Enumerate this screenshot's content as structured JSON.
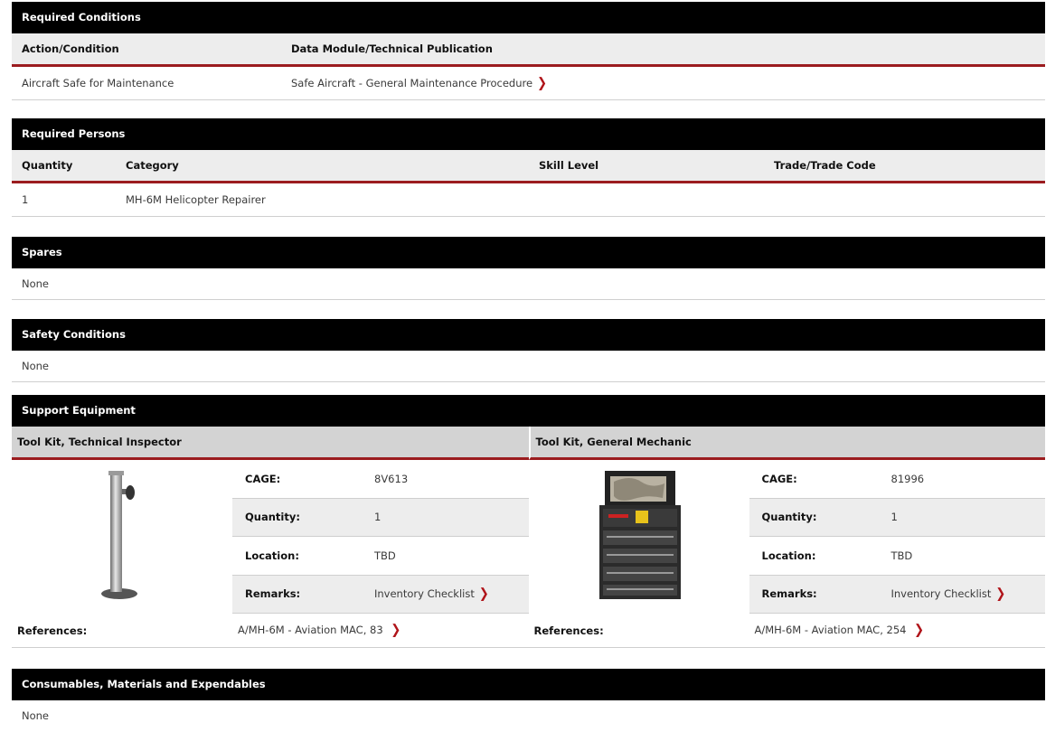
{
  "required_conditions": {
    "title": "Required Conditions",
    "headers": [
      "Action/Condition",
      "Data Module/Technical Publication"
    ],
    "rows": [
      {
        "action": "Aircraft Safe for Maintenance",
        "publication": "Safe Aircraft - General Maintenance Procedure"
      }
    ]
  },
  "required_persons": {
    "title": "Required Persons",
    "headers": [
      "Quantity",
      "Category",
      "Skill Level",
      "Trade/Trade Code"
    ],
    "rows": [
      {
        "quantity": "1",
        "category": "MH-6M Helicopter Repairer",
        "skill": "",
        "trade": ""
      }
    ]
  },
  "spares": {
    "title": "Spares",
    "value": "None"
  },
  "safety_conditions": {
    "title": "Safety Conditions",
    "value": "None"
  },
  "support_equipment": {
    "title": "Support Equipment",
    "tools": [
      {
        "name": "Tool Kit, Technical Inspector",
        "cage_label": "CAGE:",
        "cage": "8V613",
        "quantity_label": "Quantity:",
        "quantity": "1",
        "location_label": "Location:",
        "location": "TBD",
        "remarks_label": "Remarks:",
        "remarks": "Inventory Checklist",
        "references_label": "References:",
        "references": "A/MH-6M - Aviation MAC, 83"
      },
      {
        "name": "Tool Kit, General Mechanic",
        "cage_label": "CAGE:",
        "cage": "81996",
        "quantity_label": "Quantity:",
        "quantity": "1",
        "location_label": "Location:",
        "location": "TBD",
        "remarks_label": "Remarks:",
        "remarks": "Inventory Checklist",
        "references_label": "References:",
        "references": "A/MH-6M - Aviation MAC, 254"
      }
    ]
  },
  "consumables": {
    "title": "Consumables, Materials and Expendables",
    "value": "None"
  },
  "icons": {
    "link_chevron": "chevron-right-icon"
  },
  "colors": {
    "header_bar": "#000000",
    "accent": "#9b1c1f",
    "chevron": "#b0141a"
  }
}
